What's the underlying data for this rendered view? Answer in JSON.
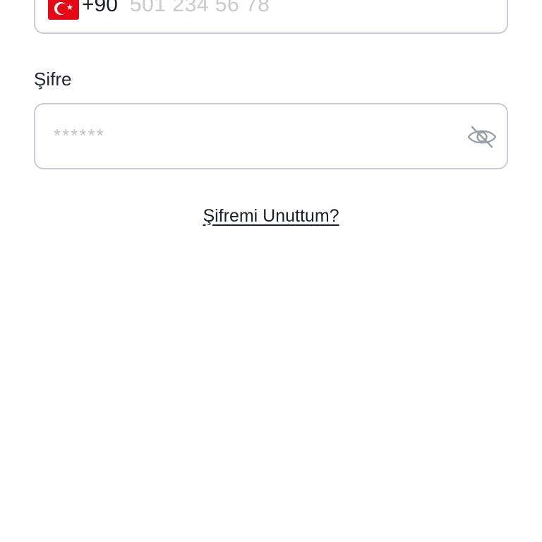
{
  "phone": {
    "country_code": "+90",
    "placeholder": "501 234 56 78",
    "flag_icon": "turkey-flag-icon"
  },
  "password": {
    "label": "Şifre",
    "placeholder": "******",
    "toggle_icon": "eye-off-icon"
  },
  "links": {
    "forgot_password": "Şifremi Unuttum?"
  },
  "colors": {
    "border": "#c9ccd8",
    "text": "#1b1f2b",
    "placeholder": "#c7c9cf",
    "flag_red": "#e30a17"
  }
}
